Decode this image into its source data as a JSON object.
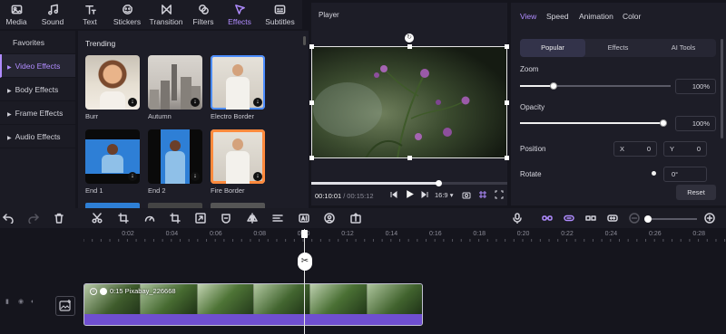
{
  "top_nav": [
    {
      "label": "Media",
      "icon": "media-icon"
    },
    {
      "label": "Sound",
      "icon": "music-note-icon"
    },
    {
      "label": "Text",
      "icon": "text-icon"
    },
    {
      "label": "Stickers",
      "icon": "sticker-icon"
    },
    {
      "label": "Transition",
      "icon": "transition-icon"
    },
    {
      "label": "Filters",
      "icon": "filter-icon"
    },
    {
      "label": "Effects",
      "icon": "effects-icon",
      "active": true
    },
    {
      "label": "Subtitles",
      "icon": "subtitles-icon"
    }
  ],
  "categories": [
    {
      "label": "Favorites"
    },
    {
      "label": "Video Effects",
      "active": true
    },
    {
      "label": "Body Effects"
    },
    {
      "label": "Frame Effects"
    },
    {
      "label": "Audio Effects"
    }
  ],
  "library": {
    "section_title": "Trending",
    "items": [
      {
        "label": "Burr"
      },
      {
        "label": "Autumn"
      },
      {
        "label": "Electro Border"
      },
      {
        "label": "End 1"
      },
      {
        "label": "End 2"
      },
      {
        "label": "Fire Border"
      }
    ]
  },
  "player": {
    "title": "Player",
    "current_time": "00:10:01",
    "separator": "/",
    "total_time": "00:15:12",
    "aspect_ratio": "16:9",
    "progress": 0.65
  },
  "properties": {
    "tabs": [
      "View",
      "Speed",
      "Animation",
      "Color"
    ],
    "active_tab": "View",
    "subtabs": [
      "Popular",
      "Effects",
      "AI Tools"
    ],
    "active_subtab": "Popular",
    "zoom_label": "Zoom",
    "zoom_value": "100%",
    "zoom_level": 0.22,
    "opacity_label": "Opacity",
    "opacity_value": "100%",
    "opacity_level": 1.0,
    "position_label": "Position",
    "x_key": "X",
    "x_value": "0",
    "y_key": "Y",
    "y_value": "0",
    "rotate_label": "Rotate",
    "rotate_value": "0°",
    "reset_label": "Reset"
  },
  "timeline": {
    "ruler_labels": [
      "0:02",
      "0:04",
      "0:06",
      "0:08",
      "0:10",
      "0:12",
      "0:14",
      "0:16",
      "0:18",
      "0:20",
      "0:22",
      "0:24",
      "0:26",
      "0:28"
    ],
    "clip_label": "0:15 Pixabay_226668",
    "clip_badge": "②"
  },
  "colors": {
    "accent": "#b08cff",
    "background": "#15151d",
    "panel": "#1d1d27",
    "clip": "#6f4fd0"
  }
}
